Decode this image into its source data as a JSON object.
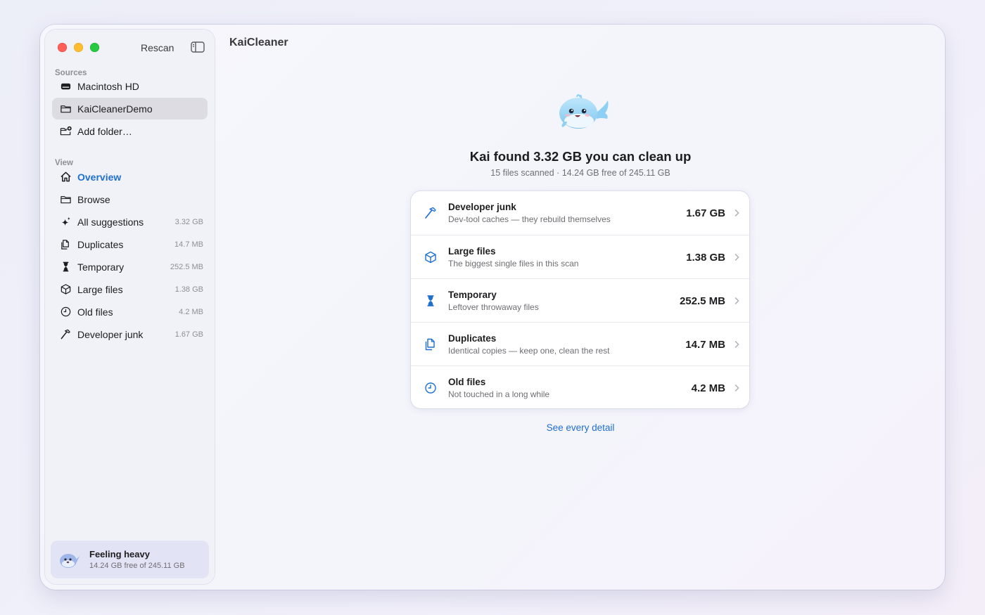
{
  "window": {
    "app_title": "KaiCleaner"
  },
  "toolbar": {
    "rescan_label": "Rescan"
  },
  "sidebar": {
    "sources_label": "Sources",
    "sources": [
      {
        "label": "Macintosh HD",
        "icon": "drive-icon"
      },
      {
        "label": "KaiCleanerDemo",
        "icon": "folder-icon",
        "selected": true
      },
      {
        "label": "Add folder…",
        "icon": "folder-add-icon"
      }
    ],
    "view_label": "View",
    "views": [
      {
        "label": "Overview",
        "icon": "house-icon",
        "size": "",
        "active": true
      },
      {
        "label": "Browse",
        "icon": "folder-icon",
        "size": ""
      },
      {
        "label": "All suggestions",
        "icon": "sparkles-icon",
        "size": "3.32 GB"
      },
      {
        "label": "Duplicates",
        "icon": "duplicate-doc-icon",
        "size": "14.7 MB"
      },
      {
        "label": "Temporary",
        "icon": "hourglass-icon",
        "size": "252.5 MB"
      },
      {
        "label": "Large files",
        "icon": "cube-icon",
        "size": "1.38 GB"
      },
      {
        "label": "Old files",
        "icon": "clock-icon",
        "size": "4.2 MB"
      },
      {
        "label": "Developer junk",
        "icon": "hammer-icon",
        "size": "1.67 GB"
      }
    ],
    "status": {
      "title": "Feeling heavy",
      "subtitle": "14.24 GB free of 245.11 GB"
    }
  },
  "main": {
    "headline": "Kai found 3.32 GB you can clean up",
    "subline": "15 files scanned · 14.24 GB free of 245.11 GB",
    "categories": [
      {
        "title": "Developer junk",
        "desc": "Dev-tool caches — they rebuild themselves",
        "amount": "1.67 GB",
        "icon": "hammer-icon"
      },
      {
        "title": "Large files",
        "desc": "The biggest single files in this scan",
        "amount": "1.38 GB",
        "icon": "cube-icon"
      },
      {
        "title": "Temporary",
        "desc": "Leftover throwaway files",
        "amount": "252.5 MB",
        "icon": "hourglass-icon"
      },
      {
        "title": "Duplicates",
        "desc": "Identical copies — keep one, clean the rest",
        "amount": "14.7 MB",
        "icon": "duplicate-doc-icon"
      },
      {
        "title": "Old files",
        "desc": "Not touched in a long while",
        "amount": "4.2 MB",
        "icon": "clock-icon"
      }
    ],
    "see_detail_label": "See every detail"
  },
  "colors": {
    "accent": "#1f6fd1",
    "close": "#ff5f57",
    "minimize": "#febc2e",
    "zoom": "#28c840"
  }
}
